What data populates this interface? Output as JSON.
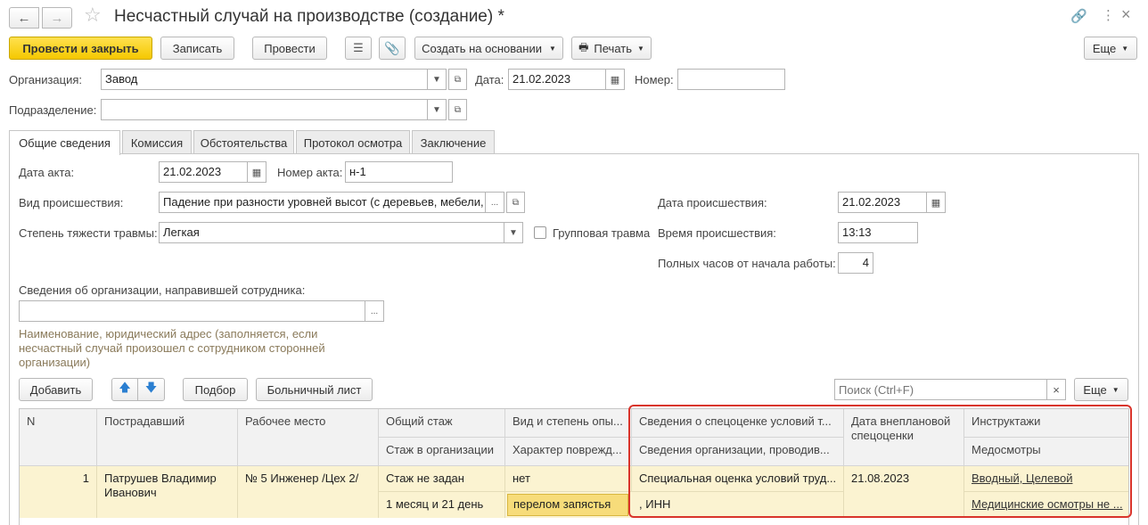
{
  "window": {
    "title": "Несчастный случай на производстве (создание) *"
  },
  "toolbar": {
    "post_close": "Провести и закрыть",
    "save": "Записать",
    "post": "Провести",
    "create_based": "Создать на основании",
    "print": "Печать",
    "more": "Еще"
  },
  "header": {
    "org_label": "Организация:",
    "org_value": "Завод",
    "date_label": "Дата:",
    "date_value": "21.02.2023",
    "number_label": "Номер:",
    "number_value": "",
    "dept_label": "Подразделение:",
    "dept_value": ""
  },
  "tabs": [
    "Общие сведения",
    "Комиссия",
    "Обстоятельства",
    "Протокол осмотра",
    "Заключение"
  ],
  "general": {
    "act_date_label": "Дата акта:",
    "act_date_value": "21.02.2023",
    "act_number_label": "Номер акта:",
    "act_number_value": "н-1",
    "incident_type_label": "Вид происшествия:",
    "incident_type_value": "Падение при разности уровней высот (с деревьев, мебели, ...",
    "severity_label": "Степень тяжести травмы:",
    "severity_value": "Легкая",
    "group_injury_label": "Групповая травма",
    "group_injury_checked": false,
    "incident_date_label": "Дата происшествия:",
    "incident_date_value": "21.02.2023",
    "incident_time_label": "Время происшествия:",
    "incident_time_value": "13:13",
    "hours_label": "Полных часов от начала работы:",
    "hours_value": "4",
    "org_sent_label": "Сведения об организации, направившей сотрудника:",
    "org_sent_value": "",
    "org_sent_hint": "Наименование, юридический адрес (заполняется, если несчастный случай произошел с сотрудником сторонней организации)"
  },
  "table_toolbar": {
    "add": "Добавить",
    "pick": "Подбор",
    "sick_leave": "Больничный лист",
    "search_placeholder": "Поиск (Ctrl+F)",
    "more": "Еще"
  },
  "table": {
    "headers": {
      "n": "N",
      "victim": "Пострадавший",
      "workplace": "Рабочее место",
      "total_exp": "Общий стаж",
      "org_exp": "Стаж в организации",
      "exp_type": "Вид и степень опы...",
      "damage": "Характер поврежд...",
      "sout": "Сведения о спецоценке условий т...",
      "sout_org": "Сведения организации, проводив...",
      "unplanned_date": "Дата внеплановой спецоценки",
      "briefings": "Инструктажи",
      "med": "Медосмотры"
    },
    "rows": [
      {
        "n": "1",
        "victim": "Патрушев Владимир Иванович",
        "workplace": "№ 5 Инженер /Цех 2/",
        "total_exp": "Стаж не задан",
        "org_exp": "1 месяц и 21 день",
        "exp_type": "нет",
        "damage": "перелом запястья",
        "sout": "Специальная оценка условий труд...",
        "sout_org": ", ИНН",
        "unplanned_date": "21.08.2023",
        "briefings": "Вводный, Целевой",
        "med": "Медицинские осмотры не ..."
      }
    ]
  },
  "colors": {
    "primary_button": "#f5c800",
    "highlight_frame": "#d9342b",
    "selected_row": "#fbf3d1"
  }
}
